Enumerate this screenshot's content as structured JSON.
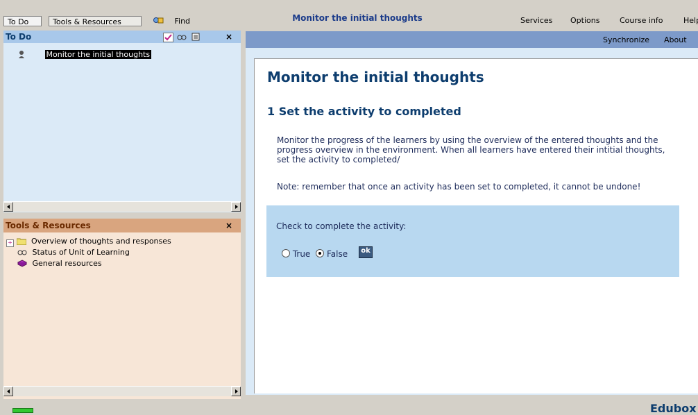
{
  "topbar": {
    "todo_tab": "To Do",
    "tools_tab": "Tools & Resources",
    "find_label": "Find",
    "title": "Monitor the initial thoughts",
    "menu": [
      "Services",
      "Options",
      "Course info",
      "Help"
    ]
  },
  "todo_panel": {
    "title": "To Do",
    "close": "×",
    "items": [
      {
        "label": "Monitor the initial thoughts",
        "icon": "person-icon"
      }
    ]
  },
  "tools_panel": {
    "title": "Tools & Resources",
    "close": "×",
    "items": [
      {
        "label": "Overview of thoughts and responses",
        "icon": "folder-icon"
      },
      {
        "label": "Status of Unit of Learning",
        "icon": "glasses-icon"
      },
      {
        "label": "General resources",
        "icon": "book-icon"
      }
    ]
  },
  "rightbar": {
    "sync": "Synchronize",
    "about": "About"
  },
  "content": {
    "title": "Monitor the initial thoughts",
    "subtitle": "1 Set the activity to completed",
    "para1": "Monitor the progress of the learners by using the overview of the entered thoughts and the progress overview in the environment. When all learners have entered their intitial thoughts, set the activity to completed/",
    "para2": "Note: remember that once an activity has been set to completed, it cannot be undone!",
    "check_label": "Check to complete the activity:",
    "option_true": "True",
    "option_false": "False",
    "selected": "False",
    "ok_label": "ok"
  },
  "statusbar": {
    "brand": "Edubox"
  },
  "colors": {
    "todo_bg": "#dbeaf7",
    "todo_head": "#a8c8ea",
    "tools_bg": "#f7e6d7",
    "tools_head": "#d9a57f",
    "title_blue": "#0d3d6e",
    "accent_blue": "#b8d8f0"
  }
}
